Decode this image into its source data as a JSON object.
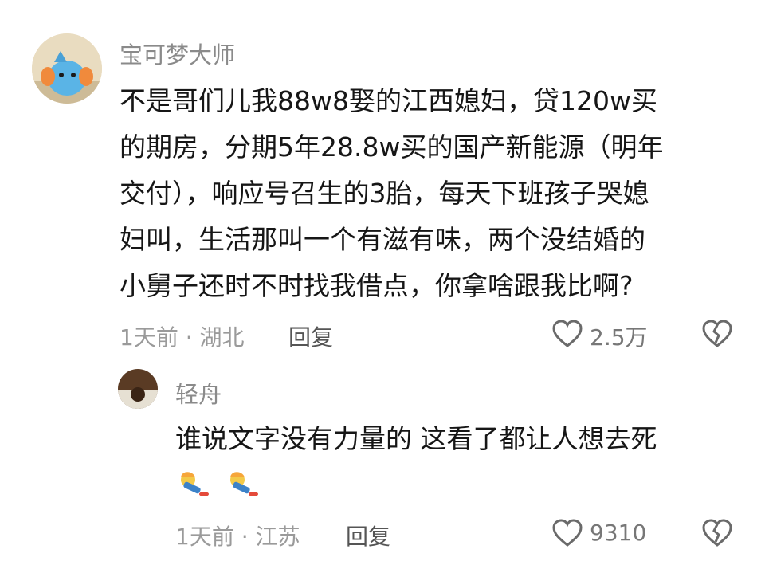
{
  "comment": {
    "user_name": "宝可梦大师",
    "text_lines": [
      "不是哥们儿我88w8娶的江西媳妇，贷120w买",
      "的期房，分期5年28.8w买的国产新能源（明年",
      "交付），响应号召生的3胎，每天下班孩子哭媳",
      "妇叫，生活那叫一个有滋有味，两个没结婚的",
      "小舅子还时不时找我借点，你拿啥跟我比啊?"
    ],
    "time": "1天前",
    "location": "湖北",
    "reply_label": "回复",
    "like_count": "2.5万"
  },
  "reply": {
    "user_name": "轻舟",
    "text": "谁说文字没有力量的 这看了都让人想去死",
    "time": "1天前",
    "location": "江苏",
    "reply_label": "回复",
    "like_count": "9310"
  },
  "separator": "·",
  "colors": {
    "accent_icon": "#6a6a6a",
    "avatar_blue": "#5ab4e6"
  }
}
